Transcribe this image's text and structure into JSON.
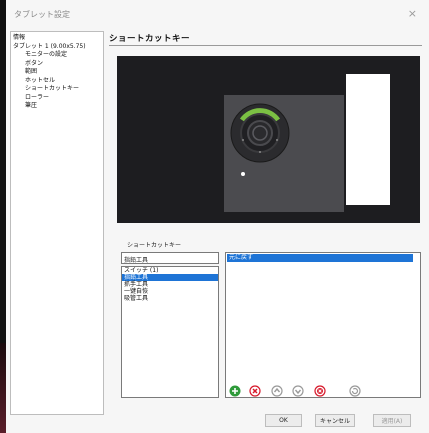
{
  "window": {
    "title": "タブレット設定",
    "close_icon": "×"
  },
  "tree": {
    "items": [
      {
        "label": "情報",
        "level": 1
      },
      {
        "label": "タブレット 1 (9.00x5.75)",
        "level": 1
      },
      {
        "label": "モニターの設定",
        "level": 2
      },
      {
        "label": "ボタン",
        "level": 2
      },
      {
        "label": "範囲",
        "level": 2
      },
      {
        "label": "ホットセル",
        "level": 2
      },
      {
        "label": "ショートカットキー",
        "level": 2
      },
      {
        "label": "ローラー",
        "level": 2
      },
      {
        "label": "筆圧",
        "level": 2
      }
    ]
  },
  "section": {
    "title": "ショートカットキー"
  },
  "shortcut": {
    "label": "ショートカットキー",
    "app_input_value": "指鉛工具",
    "apps": [
      {
        "label": "スイッチ (1)",
        "selected": false
      },
      {
        "label": "指鉛工具",
        "selected": true
      },
      {
        "label": "抓手工具",
        "selected": false
      },
      {
        "label": "一键自恢",
        "selected": false
      },
      {
        "label": "吸管工具",
        "selected": false
      }
    ],
    "keys": [
      {
        "label": "元に戻す",
        "selected": true
      }
    ]
  },
  "toolbar": {
    "add": "add-icon",
    "delete": "delete-icon",
    "move_up": "move-up-icon",
    "move_down": "move-down-icon",
    "delete_all": "delete-all-icon",
    "reset": "reset-icon"
  },
  "buttons": {
    "ok": "OK",
    "cancel": "キャンセル",
    "apply": "適用(A)"
  },
  "colors": {
    "accent": "#1e74d6",
    "ring_green": "#7bc043",
    "delete_red": "#d7192b",
    "add_green": "#2e9a3a"
  }
}
